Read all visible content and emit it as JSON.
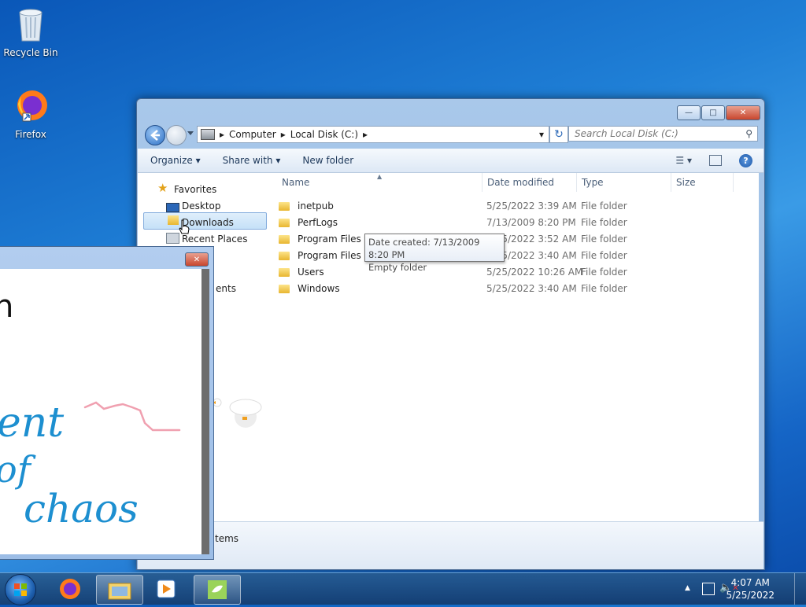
{
  "desktop": {
    "icons": [
      {
        "label": "Recycle Bin",
        "icon": "recycle-bin-icon"
      },
      {
        "label": "Firefox",
        "icon": "firefox-icon"
      }
    ]
  },
  "explorer": {
    "address": {
      "segments": [
        "Computer",
        "Local Disk (C:)"
      ]
    },
    "search": {
      "placeholder": "Search Local Disk (C:)"
    },
    "toolbar": {
      "organize": "Organize",
      "share_with": "Share with",
      "new_folder": "New folder"
    },
    "nav": {
      "favorites": "Favorites",
      "desktop": "Desktop",
      "downloads": "Downloads",
      "recent_places": "Recent Places",
      "partial_documents": "ents",
      "partial_items": "tems"
    },
    "columns": {
      "name": "Name",
      "date_modified": "Date modified",
      "type": "Type",
      "size": "Size"
    },
    "files": [
      {
        "name": "inetpub",
        "date": "5/25/2022 3:39 AM",
        "type": "File folder"
      },
      {
        "name": "PerfLogs",
        "date": "7/13/2009 8:20 PM",
        "type": "File folder"
      },
      {
        "name": "Program Files",
        "date": "5/25/2022 3:52 AM",
        "type": "File folder"
      },
      {
        "name": "Program Files (x86)",
        "date": "5/25/2022 3:40 AM",
        "type": "File folder"
      },
      {
        "name": "Users",
        "date": "5/25/2022 10:26 AM",
        "type": "File folder"
      },
      {
        "name": "Windows",
        "date": "5/25/2022 3:40 AM",
        "type": "File folder"
      }
    ],
    "tooltip": {
      "line1": "Date created: 7/13/2009 8:20 PM",
      "line2": "Empty folder"
    }
  },
  "paint": {
    "handwriting": [
      "n",
      "ent",
      "of",
      "chaos"
    ]
  },
  "taskbar": {
    "clock_time": "4:07 AM",
    "clock_date": "5/25/2022"
  }
}
